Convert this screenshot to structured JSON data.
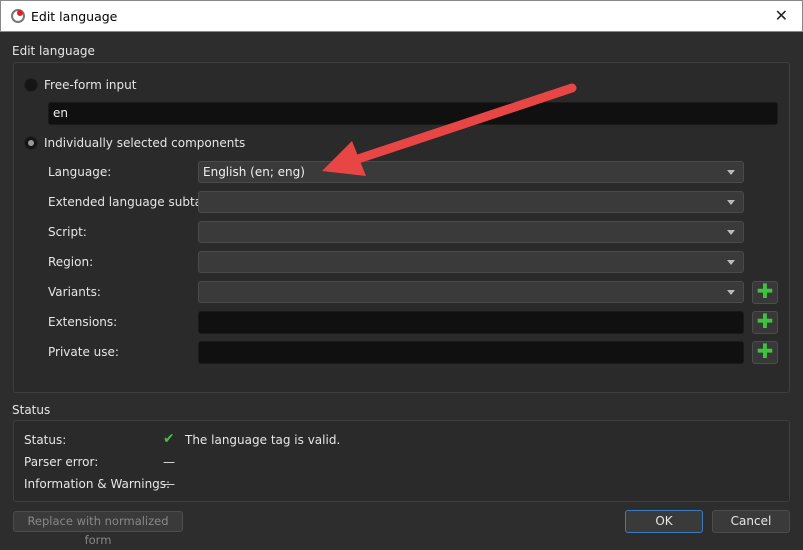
{
  "window": {
    "title": "Edit language",
    "close_icon": "close-icon"
  },
  "edit_group": {
    "title": "Edit language",
    "free_form": {
      "label": "Free-form input",
      "value": "en",
      "selected": false
    },
    "individual": {
      "label": "Individually selected components",
      "selected": true
    },
    "rows": [
      {
        "label": "Language:",
        "value": "English (en; eng)",
        "type": "combo"
      },
      {
        "label": "Extended language subtag:",
        "value": "",
        "type": "combo"
      },
      {
        "label": "Script:",
        "value": "",
        "type": "combo"
      },
      {
        "label": "Region:",
        "value": "",
        "type": "combo"
      },
      {
        "label": "Variants:",
        "value": "",
        "type": "combo",
        "add": true
      },
      {
        "label": "Extensions:",
        "value": "",
        "type": "input",
        "add": true
      },
      {
        "label": "Private use:",
        "value": "",
        "type": "input",
        "add": true
      }
    ]
  },
  "status_group": {
    "title": "Status",
    "rows": [
      {
        "label": "Status:",
        "value": "The language tag is valid.",
        "icon": "check-icon"
      },
      {
        "label": "Parser error:",
        "value": "—"
      },
      {
        "label": "Information & Warnings:",
        "value": "—"
      }
    ]
  },
  "buttons": {
    "replace": "Replace with normalized form",
    "ok": "OK",
    "cancel": "Cancel"
  },
  "colors": {
    "annotation_arrow": "#e84545",
    "check": "#3fc23f",
    "plus": "#3fc23f"
  }
}
